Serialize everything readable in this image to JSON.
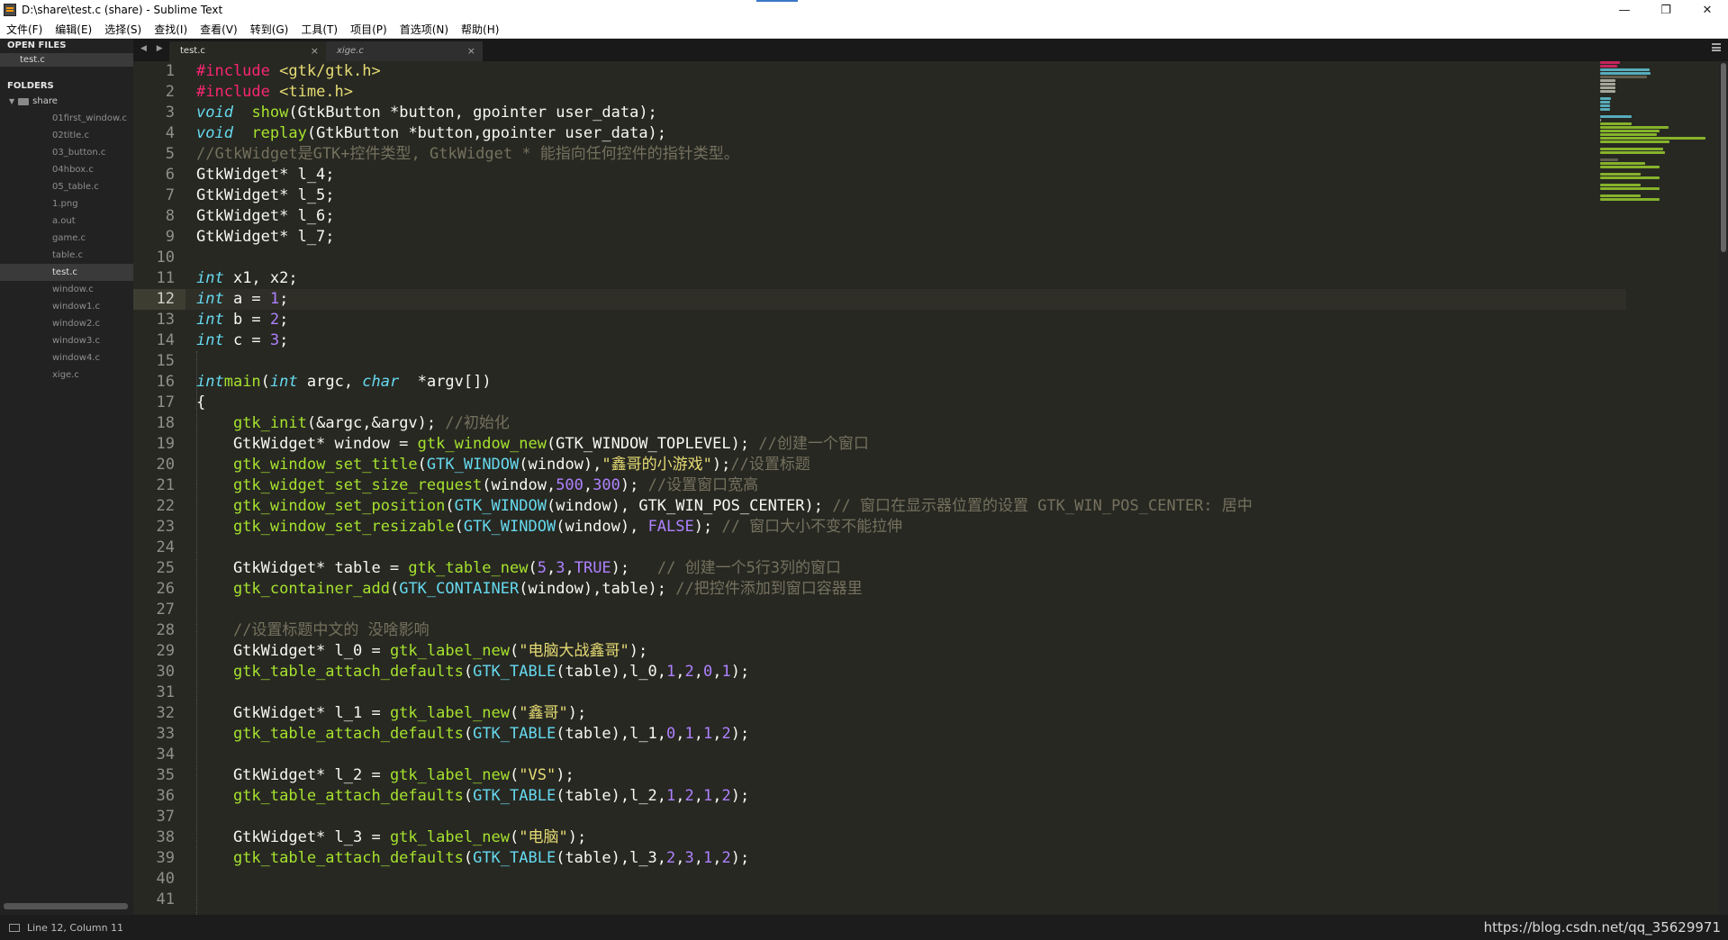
{
  "window": {
    "title": "D:\\share\\test.c (share) - Sublime Text",
    "minimize": "—",
    "restore": "❐",
    "close": "✕"
  },
  "menu": [
    "文件(F)",
    "编辑(E)",
    "选择(S)",
    "查找(I)",
    "查看(V)",
    "转到(G)",
    "工具(T)",
    "项目(P)",
    "首选项(N)",
    "帮助(H)"
  ],
  "sidebar": {
    "open_files_heading": "OPEN FILES",
    "open_files": [
      "test.c"
    ],
    "folders_heading": "FOLDERS",
    "folder": "share",
    "files": [
      "01first_window.c",
      "02title.c",
      "03_button.c",
      "04hbox.c",
      "05_table.c",
      "1.png",
      "a.out",
      "game.c",
      "table.c",
      "test.c",
      "window.c",
      "window1.c",
      "window2.c",
      "window3.c",
      "window4.c",
      "xige.c"
    ],
    "active_file_index": 9
  },
  "tabs": [
    {
      "label": "test.c",
      "active": true
    },
    {
      "label": "xige.c",
      "active": false
    }
  ],
  "tab_close_glyph": "×",
  "nav_arrows": "◀ ▶",
  "editor": {
    "current_line": 12,
    "line_numbers": [
      "1",
      "2",
      "3",
      "4",
      "5",
      "6",
      "7",
      "8",
      "9",
      "10",
      "11",
      "12",
      "13",
      "14",
      "15",
      "16",
      "17",
      "18",
      "19",
      "20",
      "21",
      "22",
      "23",
      "24",
      "25",
      "26",
      "27",
      "28",
      "29",
      "30",
      "31",
      "32",
      "33",
      "34",
      "35",
      "36",
      "37",
      "38",
      "39",
      "40",
      "41"
    ],
    "lines": [
      [
        [
          "pp",
          "#include "
        ],
        [
          "str",
          "<gtk/gtk.h>"
        ]
      ],
      [
        [
          "pp",
          "#include "
        ],
        [
          "str",
          "<time.h>"
        ]
      ],
      [
        [
          "kw",
          "void"
        ],
        [
          "",
          "  "
        ],
        [
          "fn",
          "show"
        ],
        [
          "",
          "(GtkButton *button, gpointer user_data);"
        ]
      ],
      [
        [
          "kw",
          "void"
        ],
        [
          "",
          "  "
        ],
        [
          "fn",
          "replay"
        ],
        [
          "",
          "(GtkButton *button,gpointer user_data);"
        ]
      ],
      [
        [
          "cm",
          "//GtkWidget是GTK+控件类型, GtkWidget * 能指向任何控件的指针类型。"
        ]
      ],
      [
        [
          "",
          "GtkWidget* l_4;"
        ]
      ],
      [
        [
          "",
          "GtkWidget* l_5;"
        ]
      ],
      [
        [
          "",
          "GtkWidget* l_6;"
        ]
      ],
      [
        [
          "",
          "GtkWidget* l_7;"
        ]
      ],
      [],
      [
        [
          "kw",
          "int"
        ],
        [
          "",
          " x1, x2;"
        ]
      ],
      [
        [
          "kw",
          "int"
        ],
        [
          "",
          " a = "
        ],
        [
          "num",
          "1"
        ],
        [
          "",
          ";"
        ]
      ],
      [
        [
          "kw",
          "int"
        ],
        [
          "",
          " b = "
        ],
        [
          "num",
          "2"
        ],
        [
          "",
          ";"
        ]
      ],
      [
        [
          "kw",
          "int"
        ],
        [
          "",
          " c = "
        ],
        [
          "num",
          "3"
        ],
        [
          "",
          ";"
        ]
      ],
      [],
      [
        [
          "kw",
          "int"
        ],
        [
          "",
          "",
          " "
        ],
        [
          "fn",
          "main"
        ],
        [
          "",
          "("
        ],
        [
          "kw",
          "int"
        ],
        [
          "",
          " argc, "
        ],
        [
          "kw",
          "char"
        ],
        [
          "",
          "  *argv[])"
        ]
      ],
      [
        [
          "",
          "{"
        ]
      ],
      [
        [
          "",
          "    "
        ],
        [
          "fn",
          "gtk_init"
        ],
        [
          "",
          "(&argc,&argv); "
        ],
        [
          "cm",
          "//初始化"
        ]
      ],
      [
        [
          "",
          "    GtkWidget* window = "
        ],
        [
          "fn",
          "gtk_window_new"
        ],
        [
          "",
          "(GTK_WINDOW_TOPLEVEL); "
        ],
        [
          "cm",
          "//创建一个窗口"
        ]
      ],
      [
        [
          "",
          "    "
        ],
        [
          "fn",
          "gtk_window_set_title"
        ],
        [
          "",
          "("
        ],
        [
          "mac",
          "GTK_WINDOW"
        ],
        [
          "",
          "(window),"
        ],
        [
          "str",
          "\"鑫哥的小游戏\""
        ],
        [
          "",
          ");"
        ],
        [
          "cm",
          "//设置标题"
        ]
      ],
      [
        [
          "",
          "    "
        ],
        [
          "fn",
          "gtk_widget_set_size_request"
        ],
        [
          "",
          "(window,"
        ],
        [
          "num",
          "500"
        ],
        [
          "",
          ","
        ],
        [
          "num",
          "300"
        ],
        [
          "",
          "); "
        ],
        [
          "cm",
          "//设置窗口宽高"
        ]
      ],
      [
        [
          "",
          "    "
        ],
        [
          "fn",
          "gtk_window_set_position"
        ],
        [
          "",
          "("
        ],
        [
          "mac",
          "GTK_WINDOW"
        ],
        [
          "",
          "(window), GTK_WIN_POS_CENTER); "
        ],
        [
          "cm",
          "// 窗口在显示器位置的设置 GTK_WIN_POS_CENTER: 居中"
        ]
      ],
      [
        [
          "",
          "    "
        ],
        [
          "fn",
          "gtk_window_set_resizable"
        ],
        [
          "",
          "("
        ],
        [
          "mac",
          "GTK_WINDOW"
        ],
        [
          "",
          "(window), "
        ],
        [
          "num",
          "FALSE"
        ],
        [
          "",
          "); "
        ],
        [
          "cm",
          "// 窗口大小不变不能拉伸"
        ]
      ],
      [],
      [
        [
          "",
          "    GtkWidget* table = "
        ],
        [
          "fn",
          "gtk_table_new"
        ],
        [
          "",
          "("
        ],
        [
          "num",
          "5"
        ],
        [
          "",
          ","
        ],
        [
          "num",
          "3"
        ],
        [
          "",
          ","
        ],
        [
          "num",
          "TRUE"
        ],
        [
          "",
          ");   "
        ],
        [
          "cm",
          "// 创建一个5行3列的窗口"
        ]
      ],
      [
        [
          "",
          "    "
        ],
        [
          "fn",
          "gtk_container_add"
        ],
        [
          "",
          "("
        ],
        [
          "mac",
          "GTK_CONTAINER"
        ],
        [
          "",
          "(window),table); "
        ],
        [
          "cm",
          "//把控件添加到窗口容器里"
        ]
      ],
      [],
      [
        [
          "",
          "    "
        ],
        [
          "cm",
          "//设置标题中文的 没啥影响"
        ]
      ],
      [
        [
          "",
          "    GtkWidget* l_0 = "
        ],
        [
          "fn",
          "gtk_label_new"
        ],
        [
          "",
          "("
        ],
        [
          "str",
          "\"电脑大战鑫哥\""
        ],
        [
          "",
          ");"
        ]
      ],
      [
        [
          "",
          "    "
        ],
        [
          "fn",
          "gtk_table_attach_defaults"
        ],
        [
          "",
          "("
        ],
        [
          "mac",
          "GTK_TABLE"
        ],
        [
          "",
          "(table),l_0,"
        ],
        [
          "num",
          "1"
        ],
        [
          "",
          ","
        ],
        [
          "num",
          "2"
        ],
        [
          "",
          ","
        ],
        [
          "num",
          "0"
        ],
        [
          "",
          ","
        ],
        [
          "num",
          "1"
        ],
        [
          "",
          ");"
        ]
      ],
      [],
      [
        [
          "",
          "    GtkWidget* l_1 = "
        ],
        [
          "fn",
          "gtk_label_new"
        ],
        [
          "",
          "("
        ],
        [
          "str",
          "\"鑫哥\""
        ],
        [
          "",
          ");"
        ]
      ],
      [
        [
          "",
          "    "
        ],
        [
          "fn",
          "gtk_table_attach_defaults"
        ],
        [
          "",
          "("
        ],
        [
          "mac",
          "GTK_TABLE"
        ],
        [
          "",
          "(table),l_1,"
        ],
        [
          "num",
          "0"
        ],
        [
          "",
          ","
        ],
        [
          "num",
          "1"
        ],
        [
          "",
          ","
        ],
        [
          "num",
          "1"
        ],
        [
          "",
          ","
        ],
        [
          "num",
          "2"
        ],
        [
          "",
          ");"
        ]
      ],
      [],
      [
        [
          "",
          "    GtkWidget* l_2 = "
        ],
        [
          "fn",
          "gtk_label_new"
        ],
        [
          "",
          "("
        ],
        [
          "str",
          "\"VS\""
        ],
        [
          "",
          ");"
        ]
      ],
      [
        [
          "",
          "    "
        ],
        [
          "fn",
          "gtk_table_attach_defaults"
        ],
        [
          "",
          "("
        ],
        [
          "mac",
          "GTK_TABLE"
        ],
        [
          "",
          "(table),l_2,"
        ],
        [
          "num",
          "1"
        ],
        [
          "",
          ","
        ],
        [
          "num",
          "2"
        ],
        [
          "",
          ","
        ],
        [
          "num",
          "1"
        ],
        [
          "",
          ","
        ],
        [
          "num",
          "2"
        ],
        [
          "",
          ");"
        ]
      ],
      [],
      [
        [
          "",
          "    GtkWidget* l_3 = "
        ],
        [
          "fn",
          "gtk_label_new"
        ],
        [
          "",
          "("
        ],
        [
          "str",
          "\"电脑\""
        ],
        [
          "",
          ");"
        ]
      ],
      [
        [
          "",
          "    "
        ],
        [
          "fn",
          "gtk_table_attach_defaults"
        ],
        [
          "",
          "("
        ],
        [
          "mac",
          "GTK_TABLE"
        ],
        [
          "",
          "(table),l_3,"
        ],
        [
          "num",
          "2"
        ],
        [
          "",
          ","
        ],
        [
          "num",
          "3"
        ],
        [
          "",
          ","
        ],
        [
          "num",
          "1"
        ],
        [
          "",
          ","
        ],
        [
          "num",
          "2"
        ],
        [
          "",
          ");"
        ]
      ],
      [],
      []
    ]
  },
  "status": {
    "position": "Line 12, Column 11",
    "watermark": "https://blog.csdn.net/qq_35629971"
  },
  "colors": {
    "keyword": "#66d9ef",
    "function": "#a6e22e",
    "string": "#e6db74",
    "number": "#ae81ff",
    "comment": "#75715e",
    "preprocessor": "#f92672",
    "background": "#272822"
  }
}
